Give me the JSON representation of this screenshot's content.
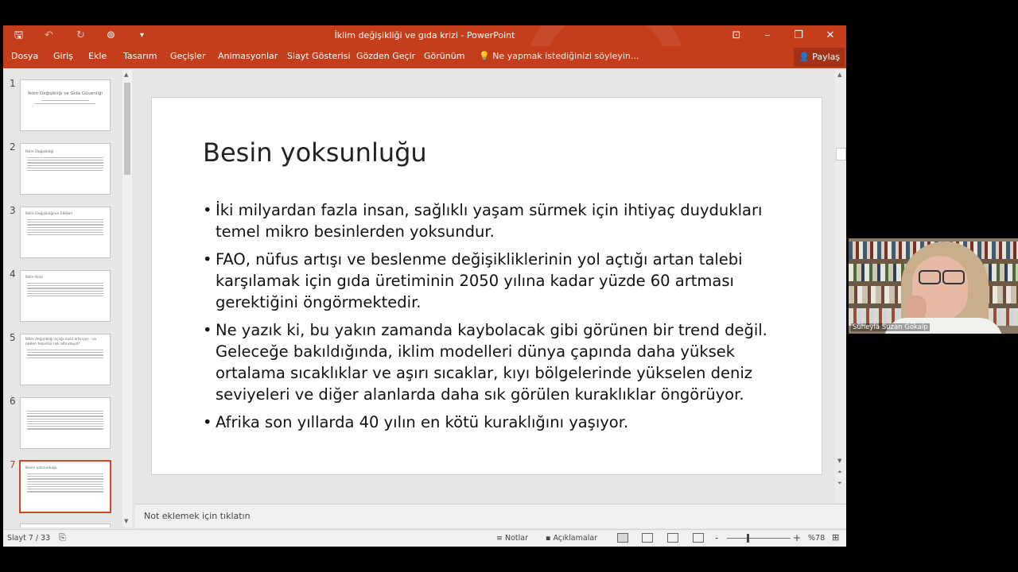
{
  "window": {
    "title": "İklim değişikliği ve gıda krizi - PowerPoint",
    "controls": {
      "minimize": "–",
      "restore": "❐",
      "close": "✕",
      "ribbon_display": "⊡"
    }
  },
  "quick_access": {
    "save": "🖫",
    "undo": "↶",
    "redo": "↻",
    "present": "⊚",
    "customize": "▾"
  },
  "menu": {
    "items": [
      "Dosya",
      "Giriş",
      "Ekle",
      "Tasarım",
      "Geçişler",
      "Animasyonlar",
      "Slayt Gösterisi",
      "Gözden Geçir",
      "Görünüm"
    ],
    "tell_me": "Ne yapmak istediğinizi söyleyin...",
    "share": "Paylaş"
  },
  "thumbnails": [
    {
      "num": "1",
      "title": "İklim Değişikliği ve Gıda Güvenliği",
      "lines": 2
    },
    {
      "num": "2",
      "title": "İklim Değişikliği",
      "lines": 6
    },
    {
      "num": "3",
      "title": "İklim Değişikliğinin Etkileri",
      "lines": 7
    },
    {
      "num": "4",
      "title": "İklim Krizi",
      "lines": 6
    },
    {
      "num": "5",
      "title": "İklim değişikliği açlığı nasıl artırıyor - ve neden hepimiz risk altındayız?",
      "lines": 4
    },
    {
      "num": "6",
      "title": "",
      "lines": 8
    },
    {
      "num": "7",
      "title": "Besin yoksunluğu",
      "lines": 8
    }
  ],
  "slide": {
    "title": "Besin yoksunluğu",
    "bullets": [
      "İki milyardan fazla insan, sağlıklı yaşam sürmek için ihtiyaç duydukları temel mikro besinlerden yoksundur.",
      "FAO, nüfus artışı ve beslenme değişikliklerinin yol açtığı artan talebi karşılamak için gıda üretiminin 2050 yılına kadar yüzde 60 artması gerektiğini öngörmektedir.",
      "Ne yazık ki, bu yakın zamanda kaybolacak gibi görünen bir trend değil. Geleceğe bakıldığında, iklim modelleri dünya çapında daha yüksek ortalama sıcaklıklar ve aşırı sıcaklar, kıyı bölgelerinde yükselen deniz seviyeleri ve diğer alanlarda daha sık görülen kuraklıklar öngörüyor.",
      "Afrika son yıllarda 40 yılın en kötü kuraklığını yaşıyor."
    ]
  },
  "notes_placeholder": "Not eklemek için tıklatın",
  "status": {
    "slide_counter": "Slayt 7 / 33",
    "notes": "Notlar",
    "comments": "Açıklamalar",
    "zoom": "%78",
    "zoom_minus": "-",
    "zoom_plus": "+"
  },
  "webcam": {
    "name": "Süheyla Suzan Gökalp"
  },
  "colors": {
    "accent": "#c43e1c",
    "selected_border": "#d24726"
  }
}
